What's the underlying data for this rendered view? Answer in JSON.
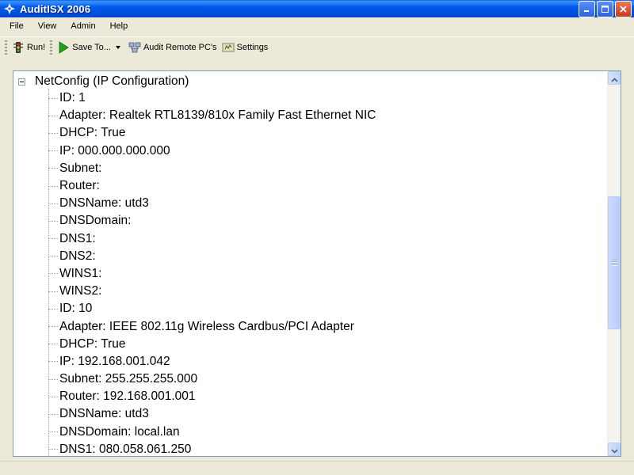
{
  "window": {
    "title": "AuditISX 2006",
    "icon": "network-star-icon",
    "controls": [
      "minimize-icon",
      "maximize-icon",
      "close-icon"
    ]
  },
  "menu": [
    "File",
    "View",
    "Admin",
    "Help"
  ],
  "toolbar": {
    "run_label": "Run!",
    "save_label": "Save To...",
    "audit_remote_label": "Audit Remote PC's",
    "settings_label": "Settings"
  },
  "tree": {
    "root_label": "NetConfig (IP Configuration)",
    "items": [
      "ID: 1",
      "Adapter: Realtek RTL8139/810x Family Fast Ethernet NIC",
      "DHCP: True",
      "IP: 000.000.000.000",
      "Subnet:",
      "Router:",
      "DNSName: utd3",
      "DNSDomain:",
      "DNS1:",
      "DNS2:",
      "WINS1:",
      "WINS2:",
      "ID: 10",
      "Adapter: IEEE 802.11g Wireless Cardbus/PCI Adapter",
      "DHCP: True",
      "IP: 192.168.001.042",
      "Subnet: 255.255.255.000",
      "Router: 192.168.001.001",
      "DNSName: utd3",
      "DNSDomain: local.lan",
      "DNS1: 080.058.061.250"
    ]
  },
  "colors": {
    "titlebar": "#0058ee",
    "window_bg": "#ece9d8",
    "tree_border": "#7f9db9",
    "scrollbar": "#c1d3fb"
  }
}
